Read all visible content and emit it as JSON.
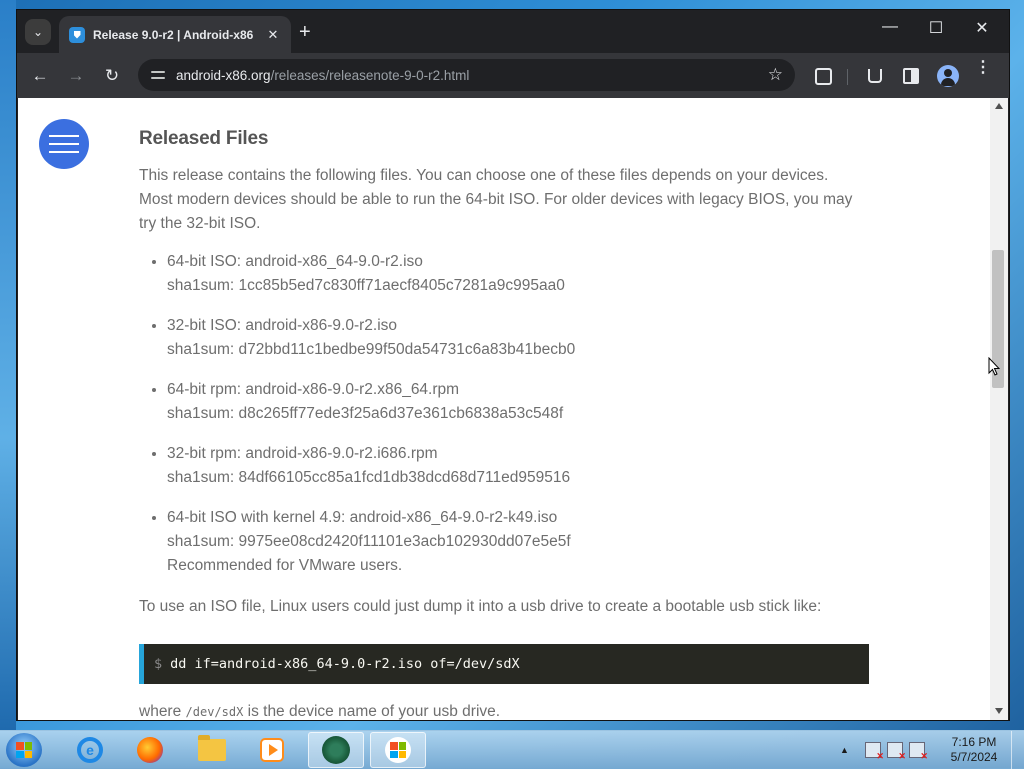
{
  "browser": {
    "tab": {
      "title": "Release 9.0-r2 | Android-x86",
      "close": "✕"
    },
    "new_tab": "+",
    "window_controls": {
      "minimize": "—",
      "maximize": "☐",
      "close": "✕"
    },
    "nav": {
      "back": "←",
      "forward": "→",
      "reload": "↻"
    },
    "address": {
      "host": "android-x86.org",
      "path": "/releases/releasenote-9-0-r2.html"
    },
    "bookmark_star": "☆",
    "menu": "⋮"
  },
  "page": {
    "heading": "Released Files",
    "intro": "This release contains the following files. You can choose one of these files depends on your devices. Most modern devices should be able to run the 64-bit ISO. For older devices with legacy BIOS, you may try the 32-bit ISO.",
    "files": [
      {
        "line1": "64-bit ISO:  android-x86_64-9.0-r2.iso",
        "line2": "sha1sum: 1cc85b5ed7c830ff71aecf8405c7281a9c995aa0",
        "line3": ""
      },
      {
        "line1": "32-bit ISO:  android-x86-9.0-r2.iso",
        "line2": "sha1sum: d72bbd11c1bedbe99f50da54731c6a83b41becb0",
        "line3": ""
      },
      {
        "line1": "64-bit rpm:  android-x86-9.0-r2.x86_64.rpm",
        "line2": "sha1sum: d8c265ff77ede3f25a6d37e361cb6838a53c548f",
        "line3": ""
      },
      {
        "line1": "32-bit rpm:  android-x86-9.0-r2.i686.rpm",
        "line2": "sha1sum: 84df66105cc85a1fcd1db38dcd68d711ed959516",
        "line3": ""
      },
      {
        "line1": "64-bit ISO with kernel 4.9:  android-x86_64-9.0-r2-k49.iso",
        "line2": "sha1sum: 9975ee08cd2420f11101e3acb102930dd07e5e5f",
        "line3": "Recommended for VMware users."
      }
    ],
    "usb_text": "To use an ISO file, Linux users could just dump it into a usb drive to create a bootable usb stick like:",
    "code": {
      "prompt": "$",
      "command": "dd if=android-x86_64-9.0-r2.iso of=/dev/sdX"
    },
    "tail": {
      "before": "where ",
      "code": "/dev/sdX",
      "after": " is the device name of your usb drive."
    }
  },
  "taskbar": {
    "apps": [
      "internet-explorer",
      "firefox",
      "file-explorer",
      "media-player",
      "chrome",
      "windows-explorer"
    ],
    "clock": {
      "time": "7:16 PM",
      "date": "5/7/2024"
    },
    "tray_arrow": "▲"
  }
}
